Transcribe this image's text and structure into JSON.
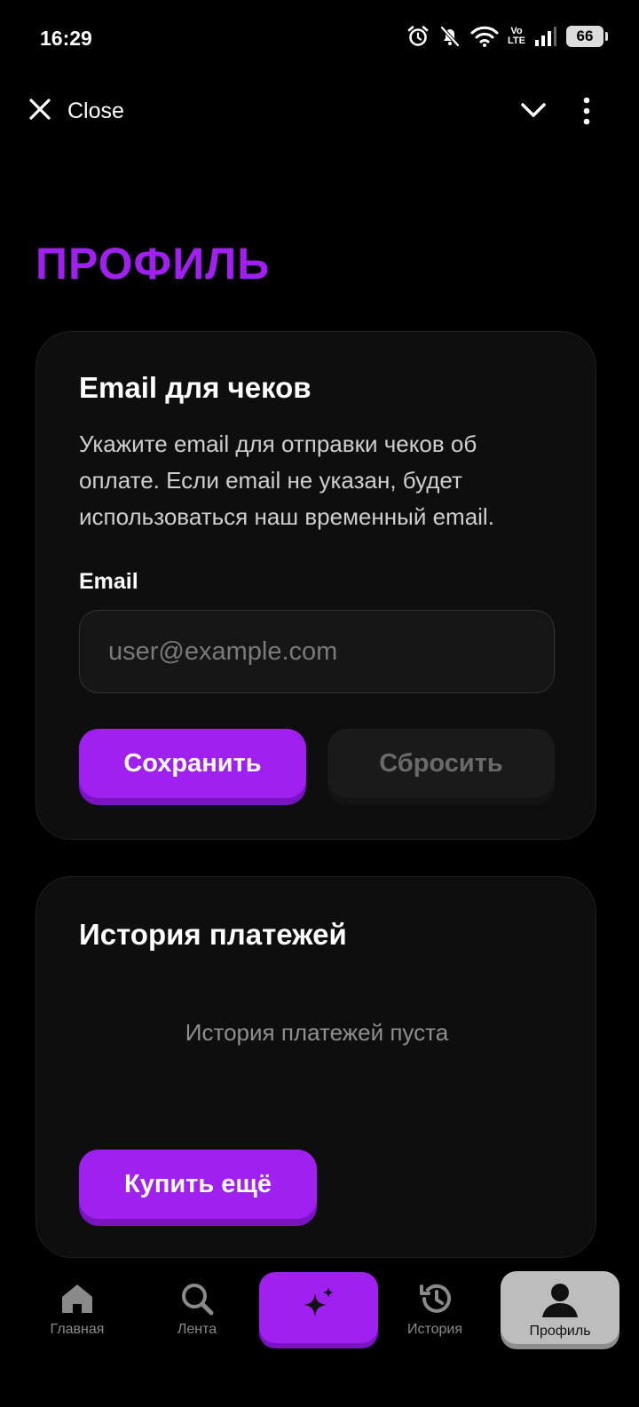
{
  "status_bar": {
    "time": "16:29",
    "volte_top": "Vo",
    "volte_bottom": "LTE",
    "battery": "66"
  },
  "top_bar": {
    "close_label": "Close"
  },
  "page": {
    "title": "ПРОФИЛЬ"
  },
  "email_card": {
    "title": "Email для чеков",
    "description": "Укажите email для отправки чеков об оплате. Если email не указан, будет использоваться наш временный email.",
    "field_label": "Email",
    "input_value": "",
    "input_placeholder": "user@example.com",
    "save_label": "Сохранить",
    "reset_label": "Сбросить"
  },
  "payments_card": {
    "title": "История платежей",
    "empty_text": "История платежей пуста",
    "buy_label": "Купить ещё"
  },
  "bottom_nav": {
    "items": [
      {
        "label": "Главная",
        "icon": "home-icon"
      },
      {
        "label": "Лента",
        "icon": "search-icon"
      },
      {
        "label": "",
        "icon": "sparkle-icon"
      },
      {
        "label": "История",
        "icon": "history-icon"
      },
      {
        "label": "Профиль",
        "icon": "user-icon"
      }
    ],
    "active": "Профиль"
  },
  "colors": {
    "accent": "#a020f0",
    "background": "#000000",
    "card": "#0e0e0e"
  }
}
